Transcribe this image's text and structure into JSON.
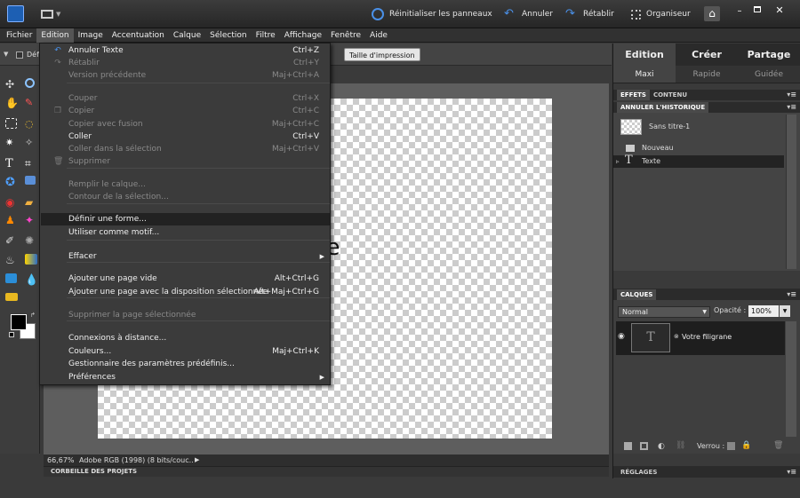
{
  "titlebar": {
    "reset_panels": "Réinitialiser les panneaux",
    "undo": "Annuler",
    "redo": "Rétablir",
    "organizer": "Organiseur"
  },
  "menubar": [
    "Fichier",
    "Edition",
    "Image",
    "Accentuation",
    "Calque",
    "Sélection",
    "Filtre",
    "Affichage",
    "Fenêtre",
    "Aide"
  ],
  "options": {
    "left_label": "Défi",
    "print_size_button": "Taille d'impression"
  },
  "edit_menu": {
    "items": [
      {
        "label": "Annuler Texte",
        "shortcut": "Ctrl+Z",
        "disabled": false,
        "icon": "undo-icon"
      },
      {
        "label": "Rétablir",
        "shortcut": "Ctrl+Y",
        "disabled": true,
        "icon": "redo-icon"
      },
      {
        "label": "Version précédente",
        "shortcut": "Maj+Ctrl+A",
        "disabled": true,
        "icon": ""
      },
      {
        "label": "Couper",
        "shortcut": "Ctrl+X",
        "disabled": true,
        "icon": ""
      },
      {
        "label": "Copier",
        "shortcut": "Ctrl+C",
        "disabled": true,
        "icon": "copy-icon"
      },
      {
        "label": "Copier avec fusion",
        "shortcut": "Maj+Ctrl+C",
        "disabled": true,
        "icon": ""
      },
      {
        "label": "Coller",
        "shortcut": "Ctrl+V",
        "disabled": false,
        "icon": ""
      },
      {
        "label": "Coller dans la sélection",
        "shortcut": "Maj+Ctrl+V",
        "disabled": true,
        "icon": ""
      },
      {
        "label": "Supprimer",
        "shortcut": "",
        "disabled": true,
        "icon": "trash-icon"
      },
      {
        "label": "Remplir le calque...",
        "shortcut": "",
        "disabled": true,
        "icon": ""
      },
      {
        "label": "Contour de la sélection...",
        "shortcut": "",
        "disabled": true,
        "icon": ""
      },
      {
        "label": "Définir une forme...",
        "shortcut": "",
        "disabled": false,
        "icon": ""
      },
      {
        "label": "Utiliser comme motif...",
        "shortcut": "",
        "disabled": false,
        "icon": ""
      },
      {
        "label": "Effacer",
        "shortcut": "",
        "disabled": false,
        "icon": ""
      },
      {
        "label": "Ajouter une page vide",
        "shortcut": "Alt+Ctrl+G",
        "disabled": false,
        "icon": ""
      },
      {
        "label": "Ajouter une page avec la disposition sélectionnée",
        "shortcut": "Alt+Maj+Ctrl+G",
        "disabled": false,
        "icon": ""
      },
      {
        "label": "Supprimer la page sélectionnée",
        "shortcut": "",
        "disabled": true,
        "icon": ""
      },
      {
        "label": "Connexions à distance...",
        "shortcut": "",
        "disabled": false,
        "icon": ""
      },
      {
        "label": "Couleurs...",
        "shortcut": "Maj+Ctrl+K",
        "disabled": false,
        "icon": ""
      },
      {
        "label": "Gestionnaire des paramètres prédéfinis...",
        "shortcut": "",
        "disabled": false,
        "icon": ""
      },
      {
        "label": "Préférences",
        "shortcut": "",
        "disabled": false,
        "icon": ""
      }
    ]
  },
  "canvas": {
    "text_fragment": "ne"
  },
  "status": {
    "zoom": "66,67%",
    "profile": "Adobe RGB (1998) (8 bits/couc..."
  },
  "project_bin": "CORBEILLE DES PROJETS",
  "panel_tabs": [
    "Edition",
    "Créer",
    "Partage"
  ],
  "panel_subtabs": [
    "Maxi",
    "Rapide",
    "Guidée"
  ],
  "effects_tabs": [
    "EFFETS",
    "CONTENU"
  ],
  "history": {
    "title": "ANNULER L'HISTORIQUE",
    "items": [
      "Sans titre-1",
      "Nouveau",
      "Texte"
    ]
  },
  "layers": {
    "title": "CALQUES",
    "blend_mode": "Normal",
    "opacity_label": "Opacité :",
    "opacity_value": "100%",
    "layer_name": "Votre filigrane",
    "lock_label": "Verrou :"
  },
  "adjustments": "RÉGLAGES",
  "colors": {
    "accent": "#2b6ec8",
    "highlight": "#222222",
    "disabled_text": "#8a8a8a"
  }
}
